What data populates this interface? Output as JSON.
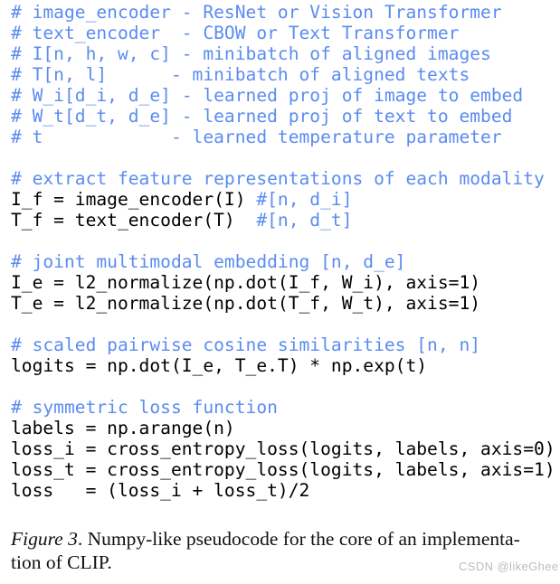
{
  "figure": {
    "background_color": "#ffffff",
    "comment_color": "#5b8cf0",
    "code_color": "#000000",
    "watermark_color": "#bdbdbd"
  },
  "pseudocode": {
    "language": "numpy-like python",
    "lines": [
      {
        "kind": "comment",
        "text": "# image_encoder - ResNet or Vision Transformer"
      },
      {
        "kind": "comment",
        "text": "# text_encoder  - CBOW or Text Transformer"
      },
      {
        "kind": "comment",
        "text": "# I[n, h, w, c] - minibatch of aligned images"
      },
      {
        "kind": "comment",
        "text": "# T[n, l]      - minibatch of aligned texts"
      },
      {
        "kind": "comment",
        "text": "# W_i[d_i, d_e] - learned proj of image to embed"
      },
      {
        "kind": "comment",
        "text": "# W_t[d_t, d_e] - learned proj of text to embed"
      },
      {
        "kind": "comment",
        "text": "# t            - learned temperature parameter"
      },
      {
        "kind": "blank",
        "text": " "
      },
      {
        "kind": "comment",
        "text": "# extract feature representations of each modality"
      },
      {
        "kind": "code",
        "code": "I_f = image_encoder(I) ",
        "comment": "#[n, d_i]"
      },
      {
        "kind": "code",
        "code": "T_f = text_encoder(T)  ",
        "comment": "#[n, d_t]"
      },
      {
        "kind": "blank",
        "text": " "
      },
      {
        "kind": "comment",
        "text": "# joint multimodal embedding [n, d_e]"
      },
      {
        "kind": "code",
        "code": "I_e = l2_normalize(np.dot(I_f, W_i), axis=1)",
        "comment": ""
      },
      {
        "kind": "code",
        "code": "T_e = l2_normalize(np.dot(T_f, W_t), axis=1)",
        "comment": ""
      },
      {
        "kind": "blank",
        "text": " "
      },
      {
        "kind": "comment",
        "text": "# scaled pairwise cosine similarities [n, n]"
      },
      {
        "kind": "code",
        "code": "logits = np.dot(I_e, T_e.T) * np.exp(t)",
        "comment": ""
      },
      {
        "kind": "blank",
        "text": " "
      },
      {
        "kind": "comment",
        "text": "# symmetric loss function"
      },
      {
        "kind": "code",
        "code": "labels = np.arange(n)",
        "comment": ""
      },
      {
        "kind": "code",
        "code": "loss_i = cross_entropy_loss(logits, labels, axis=0)",
        "comment": ""
      },
      {
        "kind": "code",
        "code": "loss_t = cross_entropy_loss(logits, labels, axis=1)",
        "comment": ""
      },
      {
        "kind": "code",
        "code": "loss   = (loss_i + loss_t)/2",
        "comment": ""
      }
    ]
  },
  "caption": {
    "label": "Figure 3",
    "label_suffix": ". ",
    "line_1": "Numpy-like pseudocode for the core of an implementa-",
    "line_2": "tion of CLIP."
  },
  "watermark": {
    "text": "CSDN @likeGhee"
  }
}
